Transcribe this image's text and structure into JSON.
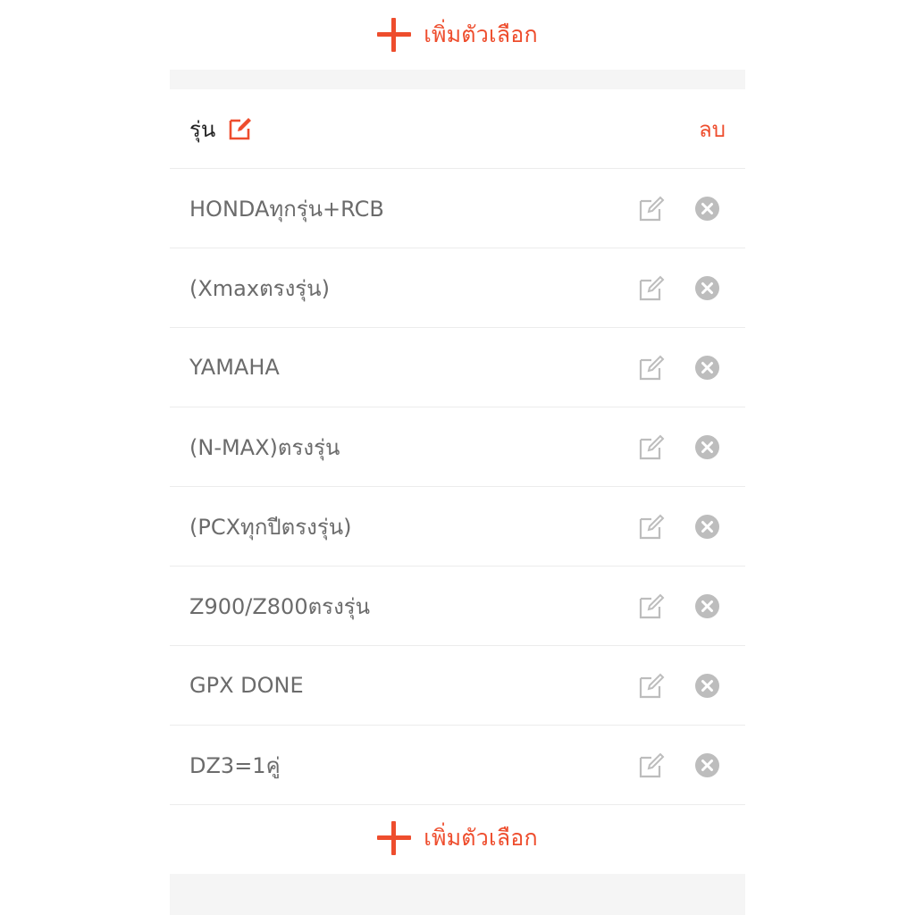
{
  "add_option": {
    "label": "เพิ่มตัวเลือก"
  },
  "variation": {
    "title": "รุ่น",
    "delete_label": "ลบ",
    "options": [
      {
        "label": "HONDAทุกรุ่น+RCB"
      },
      {
        "label": "(Xmaxตรงรุ่น)"
      },
      {
        "label": "YAMAHA"
      },
      {
        "label": "(N-MAX)ตรงรุ่น"
      },
      {
        "label": "(PCXทุกปีตรงรุ่น)"
      },
      {
        "label": "Z900/Z800ตรงรุ่น"
      },
      {
        "label": "GPX DONE"
      },
      {
        "label": "DZ3=1คู่"
      }
    ]
  },
  "colors": {
    "accent": "#ee4d2d",
    "muted_icon": "#bdbdbd",
    "text_primary": "#222222",
    "text_secondary": "#6b6b6b",
    "divider": "#ececec",
    "band": "#f5f5f5"
  },
  "icons": {
    "add": "plus-icon",
    "edit": "edit-icon",
    "remove": "close-circle-icon"
  }
}
